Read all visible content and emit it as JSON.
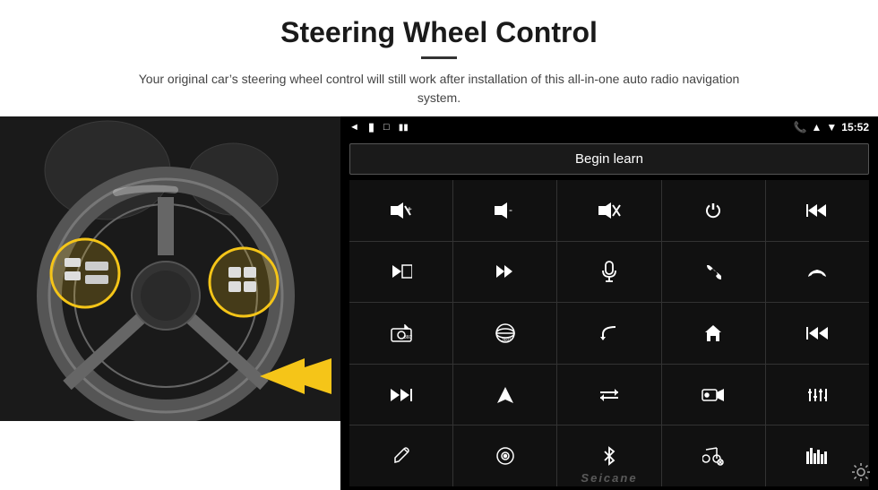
{
  "header": {
    "title": "Steering Wheel Control",
    "subtitle": "Your original car’s steering wheel control will still work after installation of this all-in-one auto radio navigation system."
  },
  "statusBar": {
    "back_icon": "◄",
    "home_icon": "█",
    "recent_icon": "□",
    "signal_icon": "♥♥",
    "phone_icon": "📞",
    "location_icon": "▲",
    "wifi_icon": "▼",
    "time": "15:52"
  },
  "beginLearn": {
    "label": "Begin learn"
  },
  "controls": [
    {
      "icon": "🔊+",
      "label": "vol-up"
    },
    {
      "icon": "🔉-",
      "label": "vol-down"
    },
    {
      "icon": "🔇",
      "label": "mute"
    },
    {
      "icon": "⏻",
      "label": "power"
    },
    {
      "icon": "⏮",
      "label": "prev-track"
    },
    {
      "icon": "⏭",
      "label": "next"
    },
    {
      "icon": "⏏⏭",
      "label": "ff"
    },
    {
      "icon": "🎤",
      "label": "mic"
    },
    {
      "icon": "📞",
      "label": "phone"
    },
    {
      "icon": "⤵",
      "label": "hang-up"
    },
    {
      "icon": "📢",
      "label": "cam"
    },
    {
      "icon": "ⓘ○",
      "label": "360"
    },
    {
      "icon": "↶",
      "label": "back"
    },
    {
      "icon": "⌂",
      "label": "home"
    },
    {
      "icon": "⏮⏮",
      "label": "prev"
    },
    {
      "icon": "⏭⏭",
      "label": "next2"
    },
    {
      "icon": "▶",
      "label": "nav"
    },
    {
      "icon": "⇆",
      "label": "swap"
    },
    {
      "icon": "📹",
      "label": "record"
    },
    {
      "icon": "⋮⋅⋮",
      "label": "eq"
    },
    {
      "icon": "✏",
      "label": "edit"
    },
    {
      "icon": "◎",
      "label": "circle-menu"
    },
    {
      "icon": "฿",
      "label": "bt"
    },
    {
      "icon": "♫",
      "label": "music"
    },
    {
      "icon": "‖‖‖",
      "label": "spectrum"
    }
  ],
  "watermark": "Seicane",
  "colors": {
    "bg": "#000000",
    "btn_bg": "#111111",
    "border": "#333333",
    "text": "#ffffff",
    "accent": "#f5c518"
  }
}
